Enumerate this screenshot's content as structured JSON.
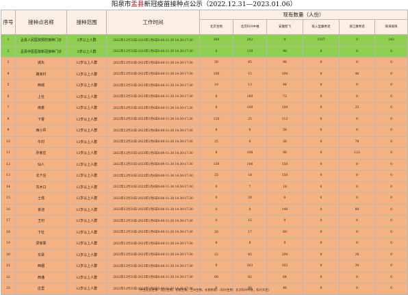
{
  "title_prefix": "阳泉市",
  "title_county": "盂县",
  "title_suffix": "新冠疫苗接种点公示（2022.12.31—2023.01.06）",
  "headers": {
    "no": "序号",
    "site": "接种点名称",
    "scope": "接种范围",
    "time": "工作时间",
    "stock": "现有数量（人份）",
    "vaccines": [
      "北京生物",
      "北京科兴中维",
      "安徽智飞",
      "吸入型康希诺",
      "浙江康希诺",
      "珠海丽珠"
    ]
  },
  "rows": [
    {
      "no": "1",
      "site": "盂县人民医院预防接种门诊",
      "scope": "3岁以上人群",
      "time": "2022年12月31日-2023年1月6日8:00-11:30   14:30-17:30",
      "v": [
        "360",
        "202",
        "0",
        "1557",
        "0",
        "542"
      ],
      "color": "green"
    },
    {
      "no": "2",
      "site": "盂县中医医院新冠接种门诊",
      "scope": "3岁以上人群",
      "time": "2022年12月31日-2023年1月6日8:00-11:30   14:30-17:30",
      "v": [
        "0",
        "130",
        "98",
        "0",
        "0",
        "0"
      ],
      "color": "green"
    },
    {
      "no": "3",
      "site": "城东",
      "scope": "12岁以上人群",
      "time": "2022年12月31日-2023年1月6日8:00-11:30   14:30-17:30",
      "v": [
        "30",
        "45",
        "98",
        "0",
        "0",
        "0"
      ],
      "color": "orange"
    },
    {
      "no": "4",
      "site": "路家村",
      "scope": "12岁以上人群",
      "time": "2022年12月31日-2023年1月6日8:00-11:30   14:30-17:30",
      "v": [
        "100",
        "15",
        "100",
        "0",
        "46",
        "0"
      ],
      "color": "orange"
    },
    {
      "no": "5",
      "site": "西城",
      "scope": "12岁以上人群",
      "time": "2022年12月31日-2023年1月6日8:00-11:30   14:30-17:30",
      "v": [
        "19",
        "13",
        "44",
        "0",
        "0",
        "0"
      ],
      "color": "orange"
    },
    {
      "no": "6",
      "site": "上社",
      "scope": "12岁以上人群",
      "time": "2022年12月31日-2023年1月6日8:00-11:30   14:30-17:30",
      "v": [
        "0",
        "180",
        "72",
        "0",
        "0",
        "0"
      ],
      "color": "orange"
    },
    {
      "no": "7",
      "site": "南娄",
      "scope": "12岁以上人群",
      "time": "2022年12月31日-2023年1月6日8:00-11:30   14:30-17:30",
      "v": [
        "0",
        "100",
        "100",
        "0",
        "25",
        "0"
      ],
      "color": "orange"
    },
    {
      "no": "8",
      "site": "下曹",
      "scope": "12岁以上人群",
      "time": "2022年12月31日-2023年1月6日8:00-11:30   14:30-17:30",
      "v": [
        "120",
        "25",
        "112",
        "0",
        "0",
        "0"
      ],
      "color": "orange"
    },
    {
      "no": "9",
      "site": "西小坪",
      "scope": "12岁以上人群",
      "time": "2022年12月31日-2023年1月6日8:00-11:30   14:30-17:30",
      "v": [
        "0",
        "0",
        "58",
        "0",
        "0",
        "0"
      ],
      "color": "orange"
    },
    {
      "no": "10",
      "site": "牛村",
      "scope": "12岁以上人群",
      "time": "2022年12月31日-2023年1月6日8:00-11:30   14:30-17:30",
      "v": [
        "25",
        "0",
        "36",
        "0",
        "70",
        "0"
      ],
      "color": "orange"
    },
    {
      "no": "11",
      "site": "孙家庄",
      "scope": "12岁以上人群",
      "time": "2022年12月31日-2023年1月6日8:00-11:30   14:30-17:30",
      "v": [
        "0",
        "108",
        "96",
        "0",
        "123",
        "0"
      ],
      "color": "orange"
    },
    {
      "no": "12",
      "site": "仙人",
      "scope": "12岁以上人群",
      "time": "2022年12月31日-2023年1月6日8:00-11:30   14:30-17:30",
      "v": [
        "150",
        "106",
        "150",
        "0",
        "0",
        "0"
      ],
      "color": "orange"
    },
    {
      "no": "13",
      "site": "北下庄",
      "scope": "12岁以上人群",
      "time": "2022年12月31日-2023年1月6日8:00-11:30   14:30-17:30",
      "v": [
        "25",
        "18",
        "150",
        "0",
        "0",
        "0"
      ],
      "color": "orange"
    },
    {
      "no": "14",
      "site": "东木口",
      "scope": "12岁以上人群",
      "time": "2022年12月31日-2023年1月6日8:00-11:30   14:30-17:30",
      "v": [
        "0",
        "7",
        "18",
        "0",
        "0",
        "0"
      ],
      "color": "orange"
    },
    {
      "no": "15",
      "site": "土塔",
      "scope": "12岁以上人群",
      "time": "2022年12月31日-2023年1月6日8:00-11:30   14:30-17:30",
      "v": [
        "0",
        "20",
        "0",
        "0",
        "0",
        "0"
      ],
      "color": "orange"
    },
    {
      "no": "16",
      "site": "苌池",
      "scope": "12岁以上人群",
      "time": "2022年12月31日-2023年1月6日8:00-11:30   14:30-17:30",
      "v": [
        "0",
        "0",
        "140",
        "0",
        "80",
        "0"
      ],
      "color": "orange"
    },
    {
      "no": "17",
      "site": "王村",
      "scope": "12岁以上人群",
      "time": "2022年12月31日-2023年1月6日8:00-11:30   14:30-17:30",
      "v": [
        "0",
        "15",
        "0",
        "0",
        "0",
        "0"
      ],
      "color": "orange"
    },
    {
      "no": "18",
      "site": "下社",
      "scope": "12岁以上人群",
      "time": "2022年12月31日-2023年1月6日8:00-11:30   14:30-17:30",
      "v": [
        "20",
        "17",
        "60",
        "0",
        "0",
        "0"
      ],
      "color": "orange"
    },
    {
      "no": "19",
      "site": "梁家寨",
      "scope": "12岁以上人群",
      "time": "2022年12月31日-2023年1月6日8:00-11:30   14:30-17:30",
      "v": [
        "0",
        "8",
        "0",
        "0",
        "0",
        "0"
      ],
      "color": "orange"
    },
    {
      "no": "20",
      "site": "东梁",
      "scope": "12岁以上人群",
      "time": "2022年12月31日-2023年1月6日8:00-11:30   14:30-17:30",
      "v": [
        "22",
        "45",
        "200",
        "0",
        "28",
        "0"
      ],
      "color": "orange"
    },
    {
      "no": "21",
      "site": "西烟",
      "scope": "12岁以上人群",
      "time": "2022年12月31日-2023年1月6日8:00-11:30   14:30-17:30",
      "v": [
        "0",
        "202",
        "302",
        "0",
        "30",
        "0"
      ],
      "color": "orange"
    },
    {
      "no": "22",
      "site": "西潘",
      "scope": "12岁以上人群",
      "time": "2022年12月31日-2023年1月6日8:00-11:30   14:30-17:30",
      "v": [
        "60",
        "82",
        "64",
        "0",
        "0",
        "0"
      ],
      "color": "orange"
    },
    {
      "no": "23",
      "site": "庄里",
      "scope": "12岁以上人群",
      "time": "2022年12月31日-2023年1月6日8:00-11:30   14:30-17:30",
      "v": [
        "0",
        "80",
        "46",
        "0",
        "0",
        "0"
      ],
      "color": "orange"
    }
  ],
  "footer": "（中生北京生物：北京生物，长春生物，兰州生物，长春祈健）（科兴生物：北京科兴中维，科兴大连）",
  "colors": {
    "green": "#8fd14f",
    "orange": "#f4b283",
    "header": "#fdeee4"
  }
}
